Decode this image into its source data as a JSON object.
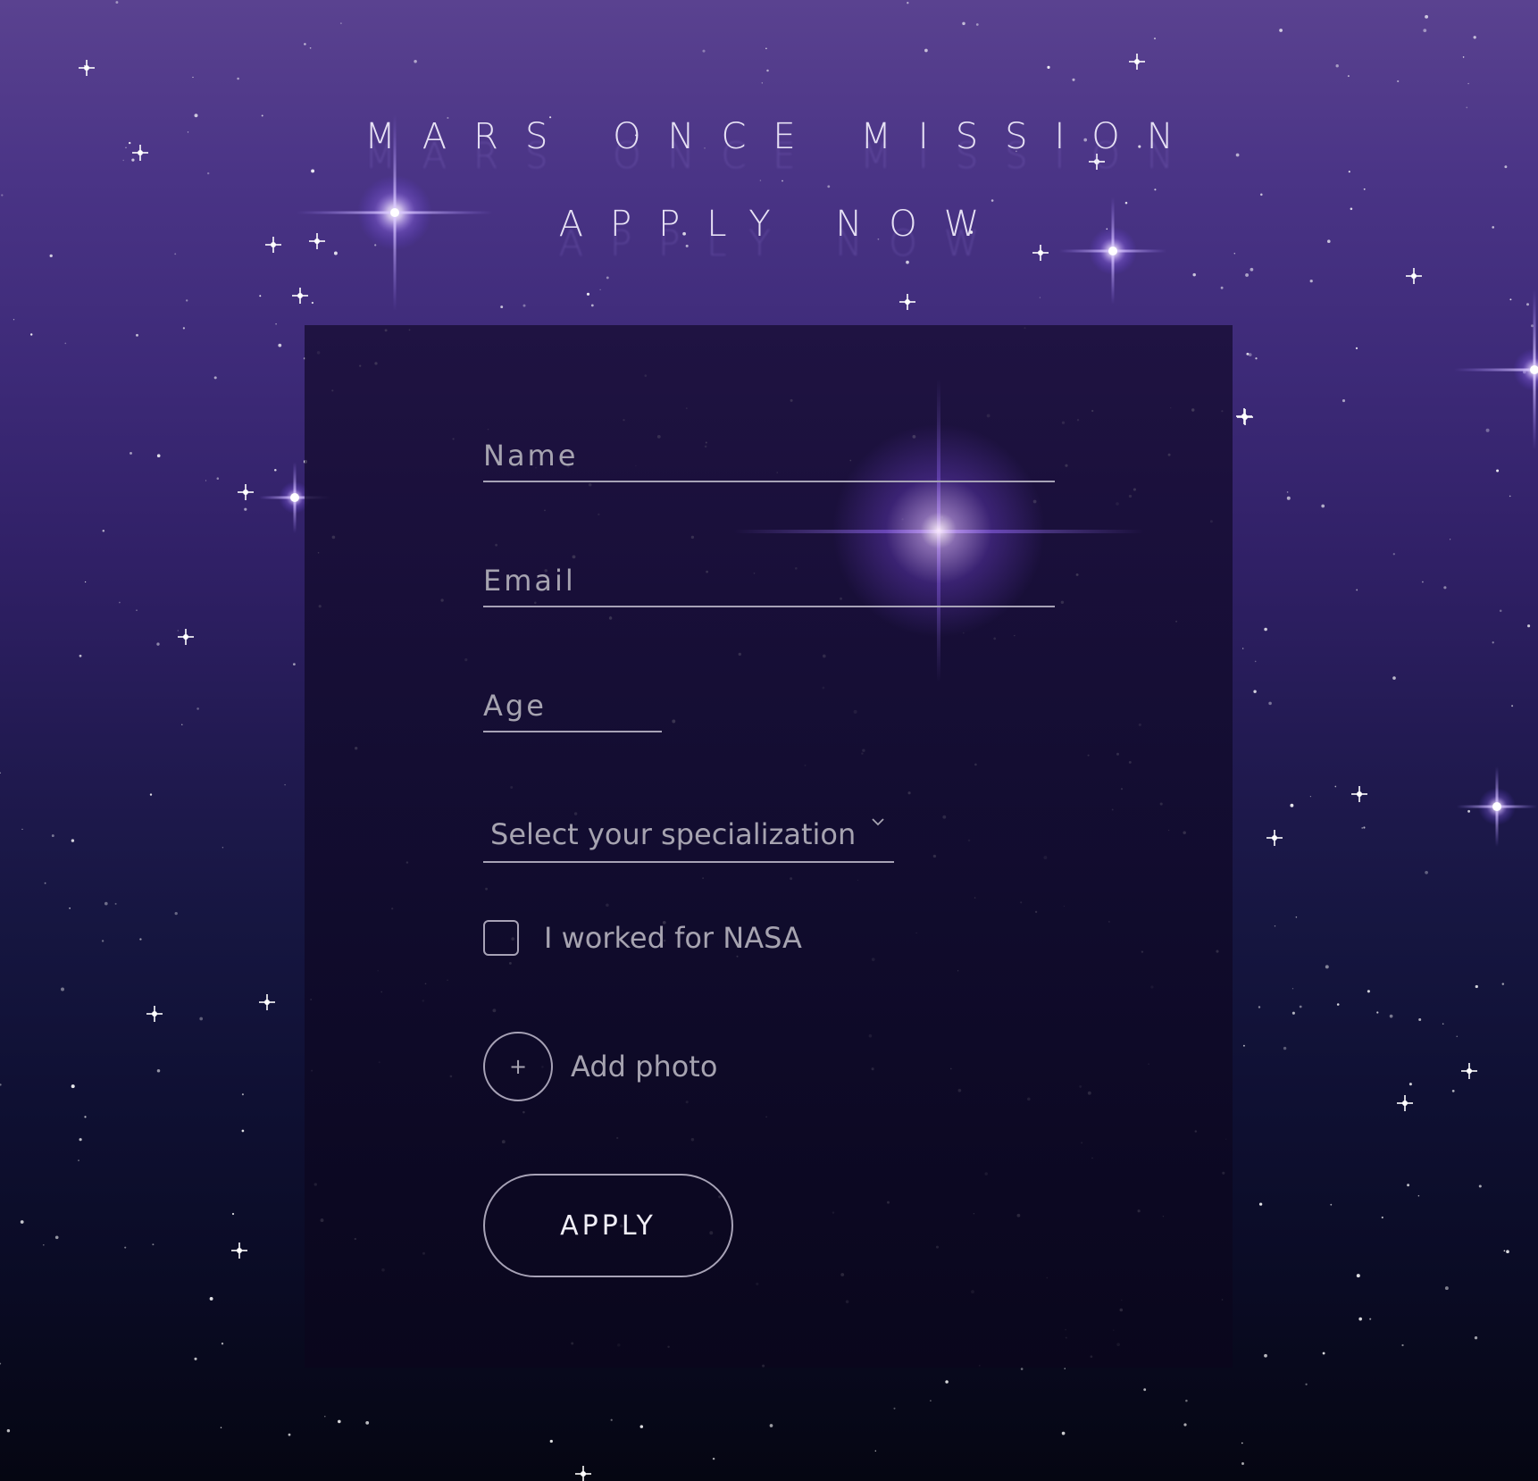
{
  "header": {
    "title": "MARS ONCE MISSION",
    "subtitle": "APPLY NOW"
  },
  "form": {
    "name_placeholder": "Name",
    "email_placeholder": "Email",
    "age_placeholder": "Age",
    "specialization_placeholder": "Select your specialization",
    "nasa_checkbox_label": "I worked for NASA",
    "nasa_checked": false,
    "add_photo_icon": "+",
    "add_photo_label": "Add photo",
    "apply_label": "APPLY"
  },
  "icons": {
    "specialization": "chevron-down-icon",
    "photo": "plus-icon"
  },
  "colors": {
    "background_top": "#5a4290",
    "background_bottom": "#050612",
    "form_text": "#a6a3b0",
    "underline": "#a7a2b6",
    "button_text": "#f0eef6"
  }
}
